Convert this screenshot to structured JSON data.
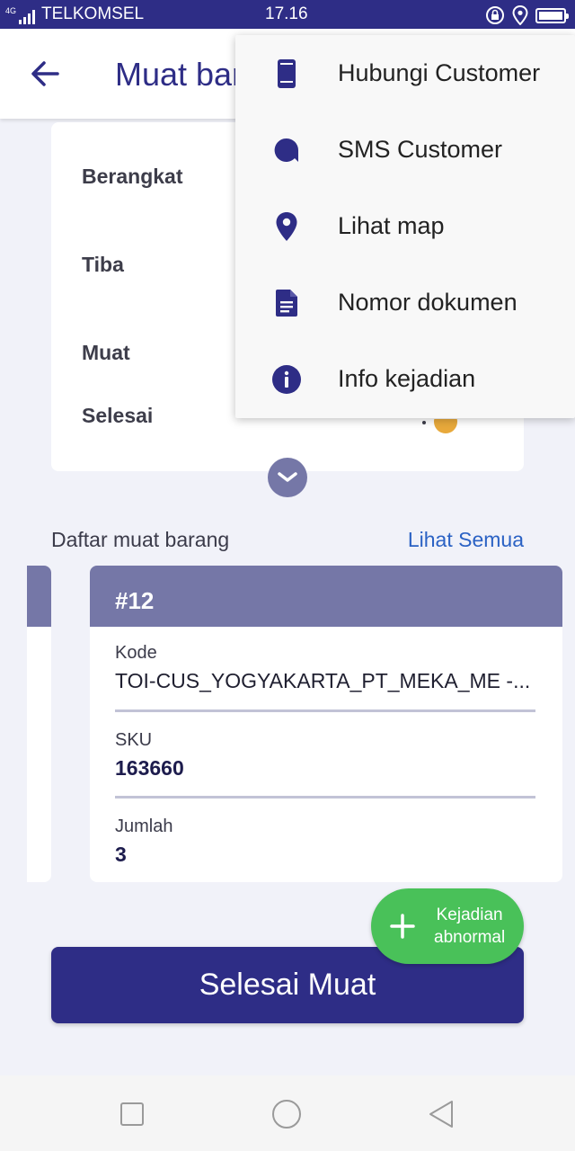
{
  "status_bar": {
    "network": "4G",
    "carrier": "TELKOMSEL",
    "time": "17.16"
  },
  "app_bar": {
    "title": "Muat barang"
  },
  "info_card": {
    "labels": [
      "Berangkat",
      "Tiba",
      "Muat",
      "Selesai"
    ]
  },
  "list": {
    "title": "Daftar muat barang",
    "see_all": "Lihat Semua",
    "item": {
      "number": "#12",
      "kode_label": "Kode",
      "kode_value": "TOI-CUS_YOGYAKARTA_PT_MEKA_ME -...",
      "sku_label": "SKU",
      "sku_value": "163660",
      "jumlah_label": "Jumlah",
      "jumlah_value": "3"
    }
  },
  "fab": {
    "line1": "Kejadian",
    "line2": "abnormal"
  },
  "primary_button": "Selesai Muat",
  "menu": {
    "items": [
      {
        "label": "Hubungi Customer",
        "icon": "phone-icon"
      },
      {
        "label": "SMS Customer",
        "icon": "chat-icon"
      },
      {
        "label": "Lihat map",
        "icon": "map-pin-icon"
      },
      {
        "label": "Nomor dokumen",
        "icon": "document-icon"
      },
      {
        "label": "Info kejadian",
        "icon": "info-icon"
      }
    ]
  },
  "colors": {
    "primary": "#2e2d86",
    "card_header": "#7577a7",
    "fab": "#49c159",
    "link": "#2b62c4",
    "status_dot": "#e8a93b"
  }
}
